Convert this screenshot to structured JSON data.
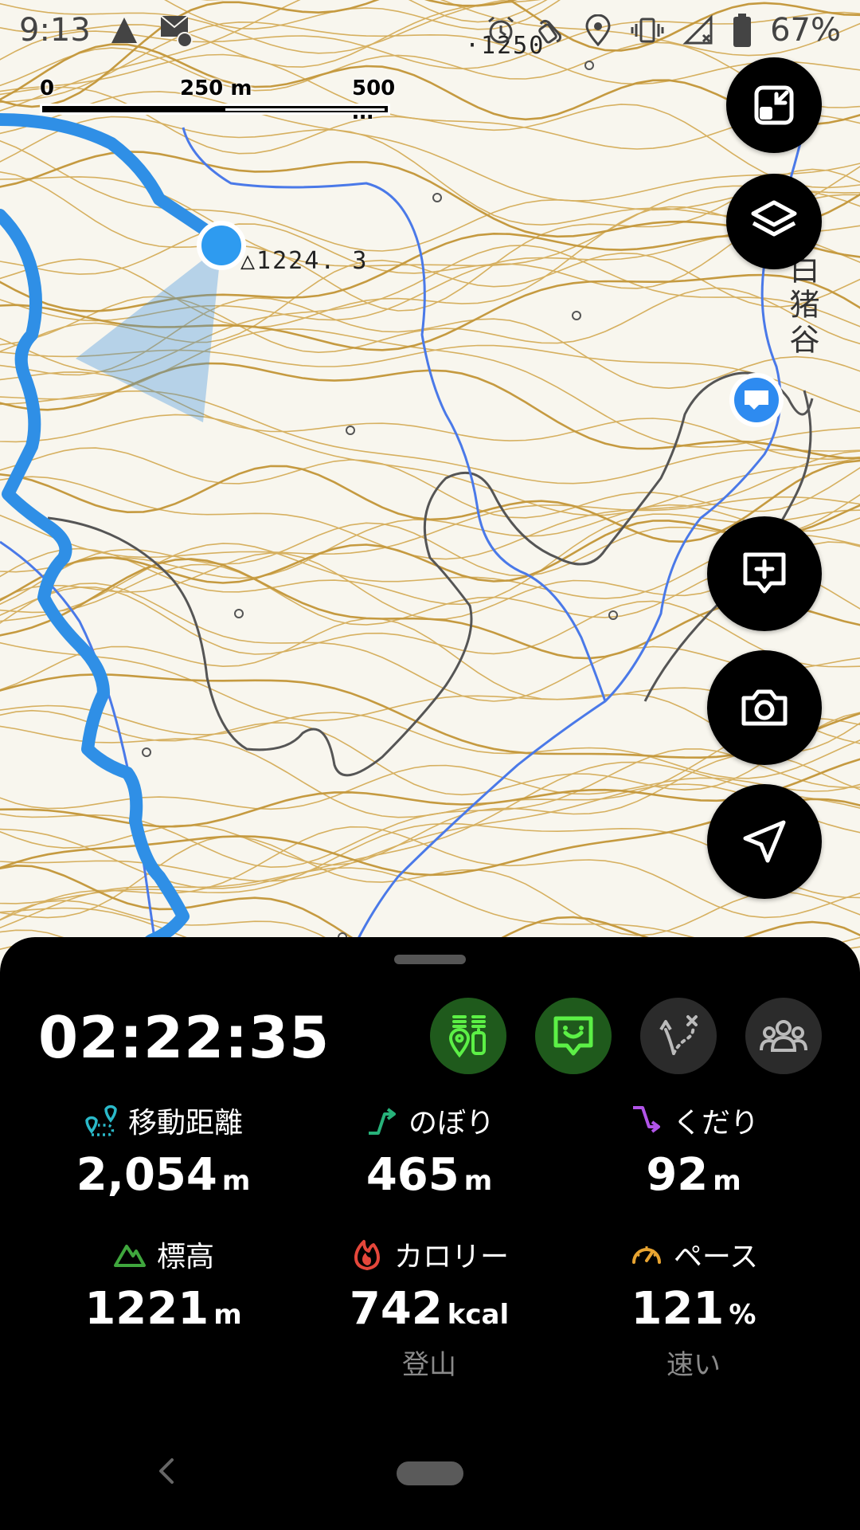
{
  "status_bar": {
    "time": "9:13",
    "battery_text": "67%",
    "left_icons": [
      "signal-triangle-icon",
      "mail-notification-icon"
    ],
    "right_icons": [
      "alarm-icon",
      "nfc-icon",
      "location-pin-icon",
      "vibrate-icon",
      "no-signal-icon",
      "battery-icon"
    ]
  },
  "map": {
    "scale": {
      "zero": "0",
      "mid": "250 m",
      "max": "500 m"
    },
    "labels": {
      "elevation_top": "·1250",
      "peak": "△1224. 3",
      "valley_name": "白猪谷"
    },
    "colors": {
      "track": "#2f8fe6",
      "river": "#4a79e8",
      "contour": "#d2aa55",
      "trail": "#555555",
      "position": "#2e9bf0"
    }
  },
  "map_buttons": [
    {
      "name": "collapse-map-button",
      "icon": "shrink-icon"
    },
    {
      "name": "layers-button",
      "icon": "layers-icon"
    },
    {
      "name": "add-memo-button",
      "icon": "add-comment-icon"
    },
    {
      "name": "camera-button",
      "icon": "camera-icon"
    },
    {
      "name": "navigation-button",
      "icon": "navigation-arrow-icon"
    }
  ],
  "panel": {
    "timer": "02:22:35",
    "mode_buttons": [
      {
        "name": "gear-check-toggle",
        "icon": "pins-icon",
        "active": true
      },
      {
        "name": "comment-toggle",
        "icon": "smile-comment-icon",
        "active": true
      },
      {
        "name": "route-toggle",
        "icon": "route-icon",
        "active": false
      },
      {
        "name": "group-toggle",
        "icon": "group-icon",
        "active": false
      }
    ],
    "stats": {
      "distance": {
        "label": "移動距離",
        "value": "2,054",
        "unit": "m",
        "icon_color": "#2ab9c9"
      },
      "ascent": {
        "label": "のぼり",
        "value": "465",
        "unit": "m",
        "icon_color": "#27b27a"
      },
      "descent": {
        "label": "くだり",
        "value": "92",
        "unit": "m",
        "icon_color": "#b154e8"
      },
      "elevation": {
        "label": "標高",
        "value": "1221",
        "unit": "m",
        "icon_color": "#3fa63d"
      },
      "calories": {
        "label": "カロリー",
        "value": "742",
        "unit": "kcal",
        "sub": "登山",
        "icon_color": "#e5473b"
      },
      "pace": {
        "label": "ペース",
        "value": "121",
        "unit": "%",
        "sub": "速い",
        "icon_color": "#e8a431"
      }
    }
  }
}
